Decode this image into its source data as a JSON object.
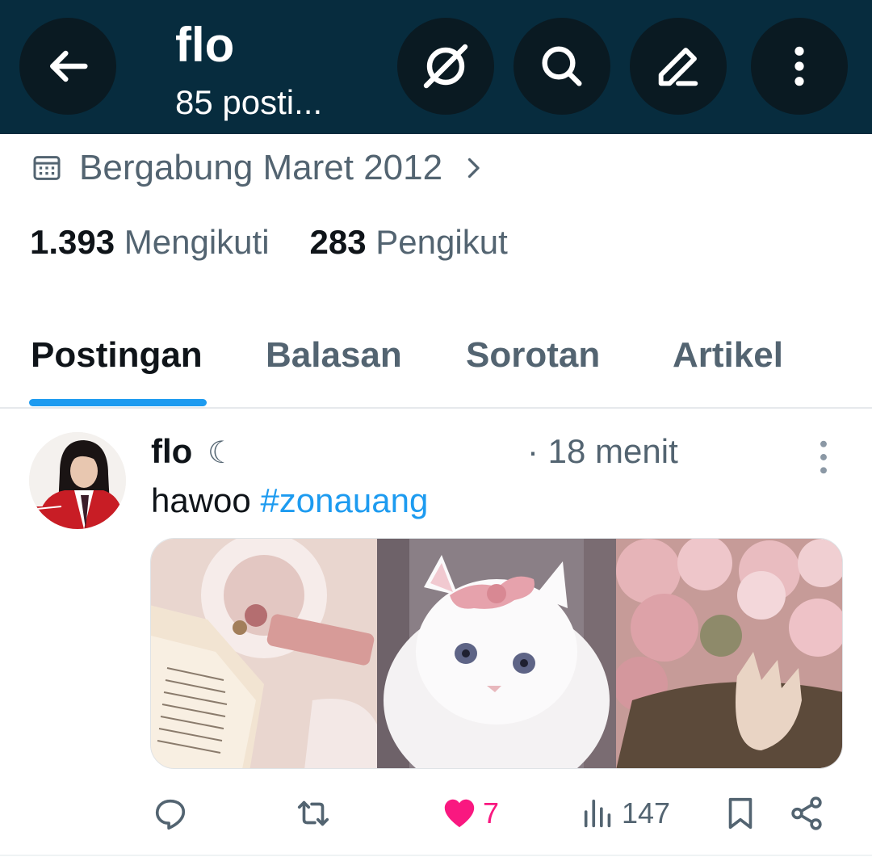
{
  "header": {
    "title": "flo",
    "subtitle": "85 posti...",
    "back_icon": "arrow-left-icon",
    "buttons": [
      "grok-icon",
      "search-icon",
      "edit-icon",
      "more-vertical-icon"
    ]
  },
  "profile": {
    "joined": "Bergabung Maret 2012",
    "following_count": "1.393",
    "following_label": "Mengikuti",
    "followers_count": "283",
    "followers_label": "Pengikut"
  },
  "tabs": [
    {
      "label": "Postingan",
      "active": true
    },
    {
      "label": "Balasan",
      "active": false
    },
    {
      "label": "Sorotan",
      "active": false
    },
    {
      "label": "Artikel",
      "active": false
    }
  ],
  "post": {
    "name": "flo",
    "name_suffix": "☾",
    "time": "· 18 menit",
    "text": "hawoo ",
    "hashtag": "#zonauang",
    "actions": {
      "reply_count": "",
      "repost_count": "",
      "like_count": "7",
      "views_count": "147"
    }
  },
  "colors": {
    "header_bg": "#072c3e",
    "accent": "#1d9bf0",
    "like": "#f91880",
    "muted": "#536471"
  }
}
